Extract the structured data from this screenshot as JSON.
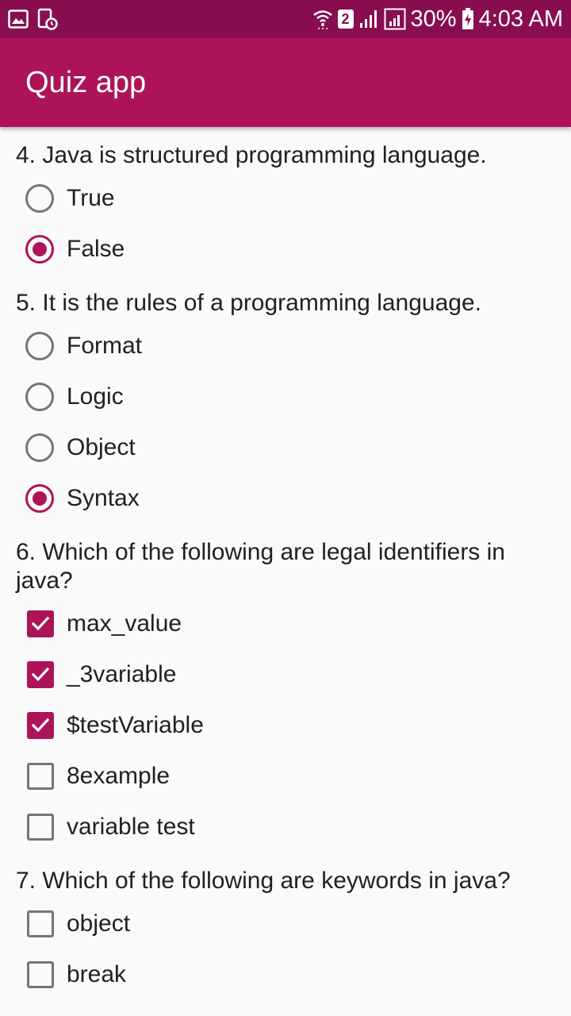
{
  "status_bar": {
    "icons_left": [
      "gallery-icon",
      "screen-timer-icon"
    ],
    "sim_number": "2",
    "battery": "30%",
    "time": "4:03 AM"
  },
  "app_bar": {
    "title": "Quiz app"
  },
  "colors": {
    "accent": "#ad1457",
    "status_bar": "#880e4f",
    "unchecked": "#757575"
  },
  "questions": [
    {
      "text": "4. Java is structured programming language.",
      "type": "radio",
      "options": [
        {
          "label": "True",
          "checked": false
        },
        {
          "label": "False",
          "checked": true
        }
      ]
    },
    {
      "text": "5. It is the rules of a programming language.",
      "type": "radio",
      "options": [
        {
          "label": "Format",
          "checked": false
        },
        {
          "label": "Logic",
          "checked": false
        },
        {
          "label": "Object",
          "checked": false
        },
        {
          "label": "Syntax",
          "checked": true
        }
      ]
    },
    {
      "text": "6. Which of the following are legal identifiers in java?",
      "type": "checkbox",
      "options": [
        {
          "label": "max_value",
          "checked": true
        },
        {
          "label": "_3variable",
          "checked": true
        },
        {
          "label": "$testVariable",
          "checked": true
        },
        {
          "label": "8example",
          "checked": false
        },
        {
          "label": "variable test",
          "checked": false
        }
      ]
    },
    {
      "text": "7. Which of the following are keywords in java?",
      "type": "checkbox",
      "options": [
        {
          "label": "object",
          "checked": false
        },
        {
          "label": "break",
          "checked": false
        }
      ]
    }
  ]
}
